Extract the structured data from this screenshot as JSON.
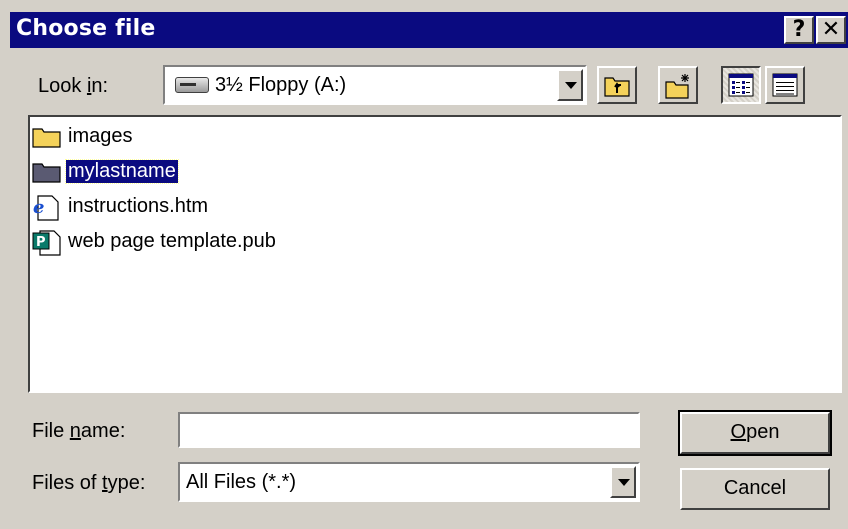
{
  "window": {
    "title": "Choose file",
    "help_label": "?",
    "close_label": "✕"
  },
  "lookin": {
    "label_pre": "Look ",
    "label_accel": "i",
    "label_post": "n:",
    "value": "3½ Floppy (A:)",
    "drive_icon": "floppy-drive-icon"
  },
  "toolbar": {
    "up_one_level": "folder-up-icon",
    "new_folder": "new-folder-icon",
    "list_view": "list-view-icon",
    "details_view": "details-view-icon"
  },
  "files": [
    {
      "name": "images",
      "icon": "folder-icon",
      "selected": false
    },
    {
      "name": "mylastname",
      "icon": "folder-icon",
      "selected": true
    },
    {
      "name": "instructions.htm",
      "icon": "ie-document-icon",
      "selected": false
    },
    {
      "name": "web page template.pub",
      "icon": "publisher-document-icon",
      "selected": false
    }
  ],
  "filename": {
    "label_pre": "File ",
    "label_accel": "n",
    "label_post": "ame:",
    "value": ""
  },
  "filetype": {
    "label_pre": "Files of ",
    "label_accel": "t",
    "label_post": "ype:",
    "value": "All Files (*.*)"
  },
  "buttons": {
    "open_accel": "O",
    "open_rest": "pen",
    "cancel": "Cancel"
  },
  "colors": {
    "titlebar": "#0a0a80",
    "face": "#d4d0c8",
    "selection": "#0a0a80",
    "folder": "#f4d25a"
  }
}
